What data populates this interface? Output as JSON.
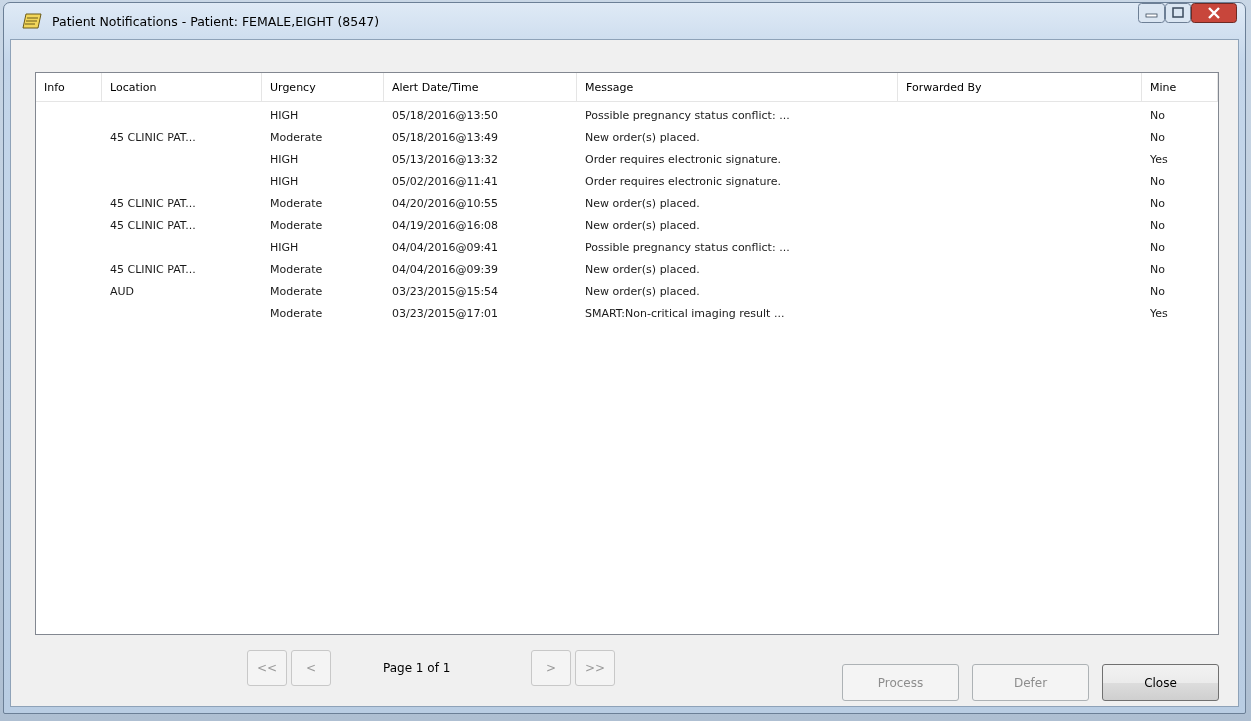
{
  "window": {
    "title": "Patient Notifications - Patient: FEMALE,EIGHT (8547)"
  },
  "table": {
    "columns": [
      "Info",
      "Location",
      "Urgency",
      "Alert Date/Time",
      "Message",
      "Forwarded By",
      "Mine"
    ],
    "rows": [
      {
        "urgency": "HIGH",
        "alert_datetime": "05/18/2016@13:50",
        "message": "Possible pregnancy status conflict: ...",
        "mine": "No"
      },
      {
        "location": "45 CLINIC PAT...",
        "urgency": "Moderate",
        "alert_datetime": "05/18/2016@13:49",
        "message": "New order(s) placed.",
        "mine": "No"
      },
      {
        "urgency": "HIGH",
        "alert_datetime": "05/13/2016@13:32",
        "message": "Order requires electronic signature.",
        "mine": "Yes"
      },
      {
        "urgency": "HIGH",
        "alert_datetime": "05/02/2016@11:41",
        "message": "Order requires electronic signature.",
        "mine": "No"
      },
      {
        "location": "45 CLINIC PAT...",
        "urgency": "Moderate",
        "alert_datetime": "04/20/2016@10:55",
        "message": "New order(s) placed.",
        "mine": "No"
      },
      {
        "location": "45 CLINIC PAT...",
        "urgency": "Moderate",
        "alert_datetime": "04/19/2016@16:08",
        "message": "New order(s) placed.",
        "mine": "No"
      },
      {
        "urgency": "HIGH",
        "alert_datetime": "04/04/2016@09:41",
        "message": "Possible pregnancy status conflict: ...",
        "mine": "No"
      },
      {
        "location": "45 CLINIC PAT...",
        "urgency": "Moderate",
        "alert_datetime": "04/04/2016@09:39",
        "message": "New order(s) placed.",
        "mine": "No"
      },
      {
        "location": "AUD",
        "urgency": "Moderate",
        "alert_datetime": "03/23/2015@15:54",
        "message": "New order(s) placed.",
        "mine": "No"
      },
      {
        "urgency": "Moderate",
        "alert_datetime": "03/23/2015@17:01",
        "message": "SMART:Non-critical imaging result ...",
        "mine": "Yes"
      }
    ]
  },
  "pager": {
    "first": {
      "label": "<<",
      "disabled": true
    },
    "prev": {
      "label": "<",
      "disabled": true
    },
    "page_label": "Page 1 of 1",
    "next": {
      "label": ">",
      "disabled": true
    },
    "last": {
      "label": ">>",
      "disabled": true
    }
  },
  "buttons": [
    {
      "label": "Process",
      "disabled": true
    },
    {
      "label": "Defer",
      "disabled": true
    },
    {
      "label": "Close",
      "disabled": false
    }
  ]
}
